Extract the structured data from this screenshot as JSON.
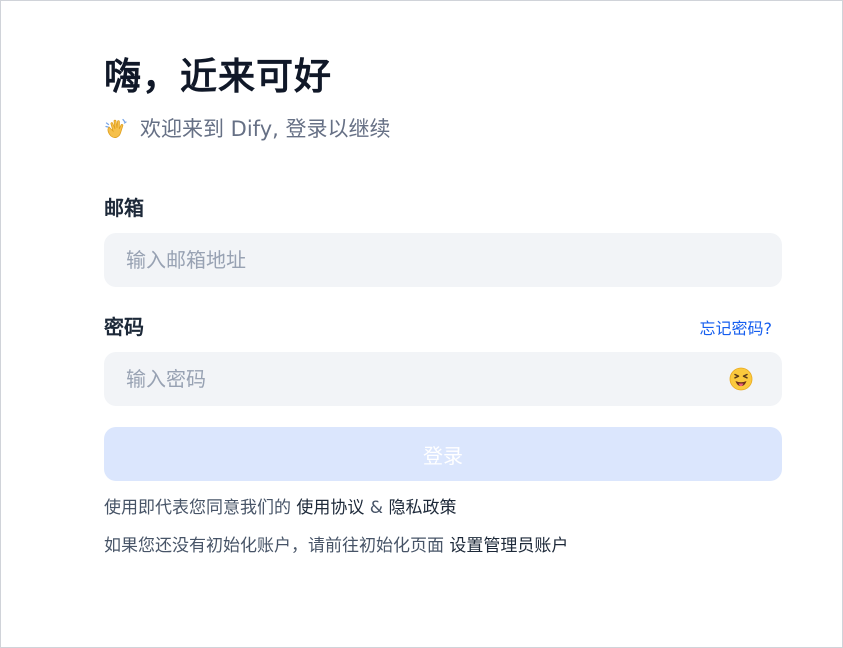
{
  "header": {
    "title": "嗨，近来可好",
    "subtitle": "欢迎来到 Dify, 登录以继续",
    "wave_icon": "waving-hand-icon"
  },
  "email": {
    "label": "邮箱",
    "placeholder": "输入邮箱地址",
    "value": ""
  },
  "password": {
    "label": "密码",
    "forgot_label": "忘记密码?",
    "placeholder": "输入密码",
    "value": "",
    "toggle_icon": "tongue-out-emoji-icon"
  },
  "login": {
    "label": "登录"
  },
  "terms": {
    "prefix": "使用即代表您同意我们的 ",
    "terms_link": "使用协议",
    "separator": " & ",
    "privacy_link": "隐私政策"
  },
  "setup": {
    "prefix": "如果您还没有初始化账户，请前往初始化页面 ",
    "link": "设置管理员账户"
  },
  "colors": {
    "accent": "#155eef",
    "button_disabled": "#dbe6fd",
    "input_bg": "#f2f4f7",
    "title": "#101828",
    "muted": "#667085"
  }
}
